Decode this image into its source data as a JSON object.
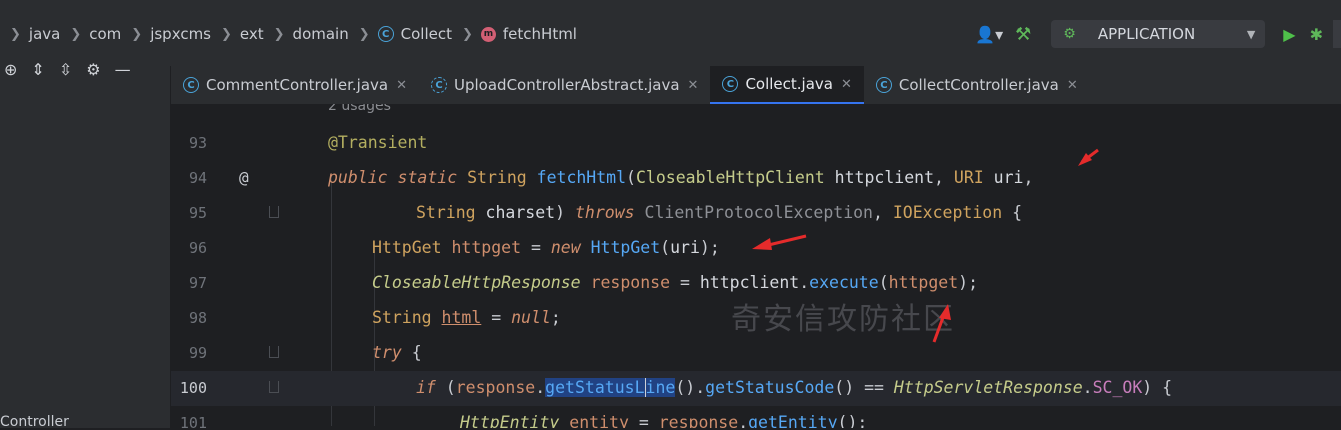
{
  "breadcrumbs": [
    {
      "label": "java",
      "icon": "none"
    },
    {
      "label": "com",
      "icon": "none"
    },
    {
      "label": "jspxcms",
      "icon": "none"
    },
    {
      "label": "ext",
      "icon": "none"
    },
    {
      "label": "domain",
      "icon": "none"
    },
    {
      "label": "Collect",
      "icon": "class-icon"
    },
    {
      "label": "fetchHtml",
      "icon": "method-icon"
    }
  ],
  "class_icon_letter": "C",
  "method_icon_letter": "m",
  "toolbar": {
    "run_config": "APPLICATION"
  },
  "tabs": [
    {
      "label": "CommentController.java",
      "active": false,
      "icon": "class-icon"
    },
    {
      "label": "UploadControllerAbstract.java",
      "active": false,
      "icon": "abstract-class-icon"
    },
    {
      "label": "Collect.java",
      "active": true,
      "icon": "class-icon"
    },
    {
      "label": "CollectController.java",
      "active": false,
      "icon": "class-icon"
    }
  ],
  "left_panel": {
    "partial_label": "Controller"
  },
  "editor": {
    "usages_hint": "2 usages",
    "current_line": 100,
    "lines": [
      {
        "num": "93"
      },
      {
        "num": "94"
      },
      {
        "num": "95"
      },
      {
        "num": "96"
      },
      {
        "num": "97"
      },
      {
        "num": "98"
      },
      {
        "num": "99"
      },
      {
        "num": "100"
      },
      {
        "num": "101"
      }
    ],
    "tokens": {
      "transient": "@Transient",
      "public": "public",
      "static": "static",
      "string": "String",
      "fetchHtml": "fetchHtml",
      "closeable_client": "CloseableHttpClient",
      "httpclient": "httpclient",
      "uri_type": "URI",
      "uri": "uri",
      "charset": "charset",
      "throws": "throws",
      "cpe": "ClientProtocolException",
      "ioe": "IOException",
      "httpget_type": "HttpGet",
      "httpget": "httpget",
      "new": "new",
      "closeable_resp": "CloseableHttpResponse",
      "response": "response",
      "execute": "execute",
      "html": "html",
      "null": "null",
      "try": "try",
      "if": "if",
      "getStatusLine_a": "getStatusL",
      "getStatusLine_b": "ine",
      "getStatusCode": "getStatusCode",
      "servlet_resp": "HttpServletResponse",
      "sc_ok": "SC_OK",
      "http_entity": "HttpEntity",
      "entity": "entity",
      "getEntity": "getEntity"
    },
    "at_marker": "@"
  },
  "watermark": "奇安信攻防社区",
  "colors": {
    "arrow": "#e52b2b",
    "accent": "#3574f0",
    "background": "#1e1f22"
  }
}
